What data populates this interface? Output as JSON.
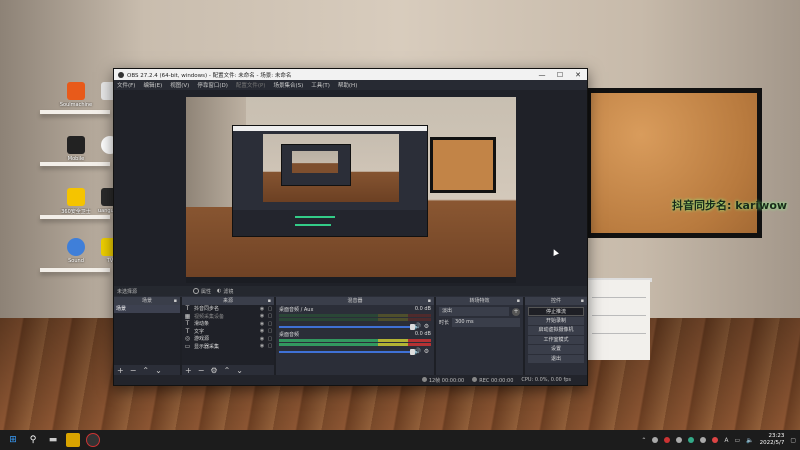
{
  "window": {
    "title": "OBS 27.2.4 (64-bit, windows) - 配置文件: 未命名 - 场景: 未命名",
    "minimize": "—",
    "maximize": "☐",
    "close": "✕"
  },
  "menu": [
    "文件(F)",
    "编辑(E)",
    "视图(V)",
    "停靠窗口(D)",
    "配置文件(P)",
    "场景集合(S)",
    "工具(T)",
    "帮助(H)"
  ],
  "preview_toolbar": {
    "no_source": "未选择源",
    "properties": "属性",
    "filters": "滤镜"
  },
  "scenes": {
    "header": "场景",
    "items": [
      "场景"
    ]
  },
  "sources": {
    "header": "来源",
    "items": [
      {
        "icon": "T",
        "name": "抖音同步名"
      },
      {
        "icon": "▦",
        "name": "视频采集设备"
      },
      {
        "icon": "T",
        "name": "滑动条"
      },
      {
        "icon": "T",
        "name": "文字"
      },
      {
        "icon": "◎",
        "name": "游戏源"
      },
      {
        "icon": "▭",
        "name": "显示器采集"
      }
    ]
  },
  "mixer": {
    "header": "混音器",
    "channels": [
      {
        "name": "桌面音频 / Aux",
        "db": "0.0 dB"
      },
      {
        "name": "桌面音频",
        "db": "0.0 dB"
      }
    ]
  },
  "transitions": {
    "header": "转场特效",
    "type": "淡出",
    "duration_label": "时长",
    "duration_value": "300 ms"
  },
  "controls": {
    "header": "控件",
    "buttons": [
      "停止推流",
      "开始录制",
      "启动虚拟摄像机",
      "工作室模式",
      "设置",
      "退出"
    ]
  },
  "status": {
    "live_time": "12帧  00:00:00",
    "rec": "REC  00:00:00",
    "cpu": "CPU: 0.0%, 0.00 fps"
  },
  "overlay_text": "抖音同步名: kariwow",
  "desktop_icons": [
    "Soulmachine",
    "",
    "Mobile",
    "",
    "360安全卫士",
    "uanguard",
    "Sound",
    "TV"
  ],
  "taskbar": {
    "time": "23:23",
    "date": "2022/5/7",
    "lang": "A"
  },
  "colors": {
    "obs_bg": "#2b2e38",
    "accent": "#3f71d6"
  }
}
